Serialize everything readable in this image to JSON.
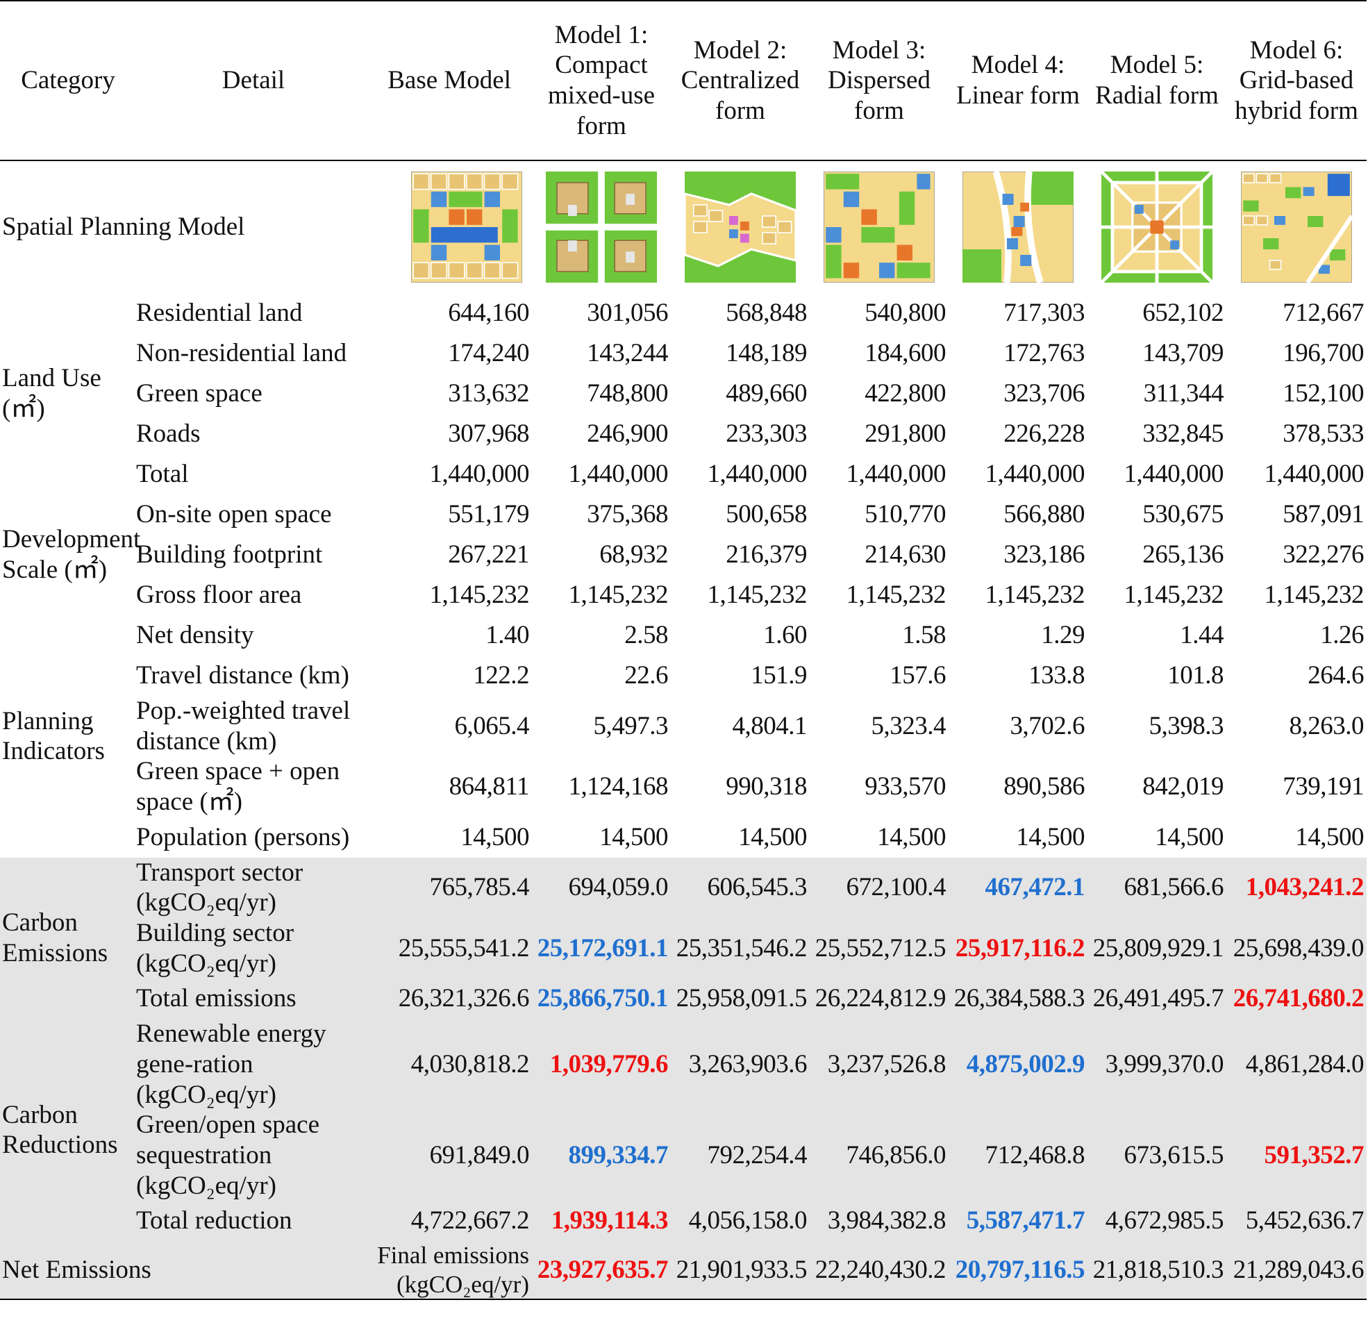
{
  "headers": [
    "Category",
    "Detail",
    "Base Model",
    "Model 1: Compact mixed-use form",
    "Model 2: Centralized form",
    "Model 3: Dispersed form",
    "Model 4: Linear form",
    "Model 5: Radial form",
    "Model 6: Grid-based hybrid form"
  ],
  "spatial_label": "Spatial Planning Model",
  "thumbs": [
    "base-model-plan",
    "compact-mixed-use-plan",
    "centralized-plan",
    "dispersed-plan",
    "linear-plan",
    "radial-plan",
    "grid-hybrid-plan"
  ],
  "groups": {
    "land_use": "Land Use (㎡)",
    "development_scale": "Development Scale (㎡)",
    "planning_indicators": "Planning Indicators",
    "carbon_emissions": "Carbon Emissions",
    "carbon_reductions": "Carbon Reductions",
    "net_emissions": "Net Emissions"
  },
  "rows": [
    {
      "detail": "Residential land",
      "values": [
        "644,160",
        "301,056",
        "568,848",
        "540,800",
        "717,303",
        "652,102",
        "712,667"
      ]
    },
    {
      "detail": "Non-residential land",
      "values": [
        "174,240",
        "143,244",
        "148,189",
        "184,600",
        "172,763",
        "143,709",
        "196,700"
      ]
    },
    {
      "detail": "Green space",
      "values": [
        "313,632",
        "748,800",
        "489,660",
        "422,800",
        "323,706",
        "311,344",
        "152,100"
      ]
    },
    {
      "detail": "Roads",
      "values": [
        "307,968",
        "246,900",
        "233,303",
        "291,800",
        "226,228",
        "332,845",
        "378,533"
      ]
    },
    {
      "detail": "Total",
      "values": [
        "1,440,000",
        "1,440,000",
        "1,440,000",
        "1,440,000",
        "1,440,000",
        "1,440,000",
        "1,440,000"
      ]
    },
    {
      "detail": "On-site open space",
      "values": [
        "551,179",
        "375,368",
        "500,658",
        "510,770",
        "566,880",
        "530,675",
        "587,091"
      ]
    },
    {
      "detail": "Building footprint",
      "values": [
        "267,221",
        "68,932",
        "216,379",
        "214,630",
        "323,186",
        "265,136",
        "322,276"
      ]
    },
    {
      "detail": "Gross floor area",
      "values": [
        "1,145,232",
        "1,145,232",
        "1,145,232",
        "1,145,232",
        "1,145,232",
        "1,145,232",
        "1,145,232"
      ]
    },
    {
      "detail": "Net density",
      "values": [
        "1.40",
        "2.58",
        "1.60",
        "1.58",
        "1.29",
        "1.44",
        "1.26"
      ]
    },
    {
      "detail": "Travel distance (km)",
      "values": [
        "122.2",
        "22.6",
        "151.9",
        "157.6",
        "133.8",
        "101.8",
        "264.6"
      ]
    },
    {
      "detail": "Pop.-weighted travel distance (km)",
      "values": [
        "6,065.4",
        "5,497.3",
        "4,804.1",
        "5,323.4",
        "3,702.6",
        "5,398.3",
        "8,263.0"
      ]
    },
    {
      "detail": "Green space + open space (㎡)",
      "values": [
        "864,811",
        "1,124,168",
        "990,318",
        "933,570",
        "890,586",
        "842,019",
        "739,191"
      ]
    },
    {
      "detail": "Population (persons)",
      "values": [
        "14,500",
        "14,500",
        "14,500",
        "14,500",
        "14,500",
        "14,500",
        "14,500"
      ]
    },
    {
      "detail": "Transport sector (kgCO₂eq/yr)",
      "values": [
        "765,785.4",
        "694,059.0",
        "606,545.3",
        "672,100.4",
        "467,472.1",
        "681,566.6",
        "1,043,241.2"
      ]
    },
    {
      "detail": "Building sector (kgCO₂eq/yr)",
      "values": [
        "25,555,541.2",
        "25,172,691.1",
        "25,351,546.2",
        "25,552,712.5",
        "25,917,116.2",
        "25,809,929.1",
        "25,698,439.0"
      ]
    },
    {
      "detail": "Total emissions",
      "values": [
        "26,321,326.6",
        "25,866,750.1",
        "25,958,091.5",
        "26,224,812.9",
        "26,384,588.3",
        "26,491,495.7",
        "26,741,680.2"
      ]
    },
    {
      "detail": "Renewable energy gene-ration (kgCO₂eq/yr)",
      "values": [
        "4,030,818.2",
        "1,039,779.6",
        "3,263,903.6",
        "3,237,526.8",
        "4,875,002.9",
        "3,999,370.0",
        "4,861,284.0"
      ]
    },
    {
      "detail": "Green/open space sequestration (kgCO₂eq/yr)",
      "values": [
        "691,849.0",
        "899,334.7",
        "792,254.4",
        "746,856.0",
        "712,468.8",
        "673,615.5",
        "591,352.7"
      ]
    },
    {
      "detail": "Total reduction",
      "values": [
        "4,722,667.2",
        "1,939,114.3",
        "4,056,158.0",
        "3,984,382.8",
        "5,587,471.7",
        "4,672,985.5",
        "5,452,636.7"
      ]
    }
  ],
  "net": {
    "label": "Final emissions (kgCO₂eq/yr)",
    "values": [
      "23,927,635.7",
      "21,901,933.5",
      "22,240,430.2",
      "20,797,116.5",
      "21,818,510.3",
      "21,289,043.6"
    ]
  },
  "highlight_colors": {
    "best": "#1f6fcf",
    "worst": "#ee1111"
  }
}
